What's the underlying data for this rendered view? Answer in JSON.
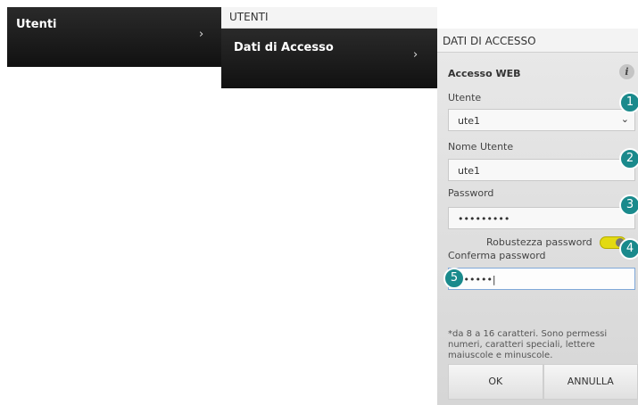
{
  "menu1": {
    "label": "Utenti",
    "chevron": "›"
  },
  "col2": {
    "header": "UTENTI",
    "item_label": "Dati di Accesso",
    "chevron": "›"
  },
  "dialog": {
    "header": "DATI DI ACCESSO",
    "section_title": "Accesso WEB",
    "info_icon": "i",
    "utente_label": "Utente",
    "utente_value": "ute1",
    "nome_utente_label": "Nome Utente",
    "nome_utente_value": "ute1",
    "password_label": "Password",
    "password_value": "•••••••••",
    "robustezza_label": "Robustezza password",
    "conferma_label": "Conferma password",
    "conferma_value": "••••••|",
    "hint": "*da 8 a 16 caratteri. Sono permessi numeri, caratteri speciali, lettere maiuscole e minuscole.",
    "ok_label": "OK",
    "annulla_label": "ANNULLA"
  },
  "callouts": [
    "1",
    "2",
    "3",
    "4",
    "5"
  ],
  "colors": {
    "callout": "#1a8a8c",
    "toggle": "#e3da12",
    "menu_bg": "#1a1a1a"
  }
}
